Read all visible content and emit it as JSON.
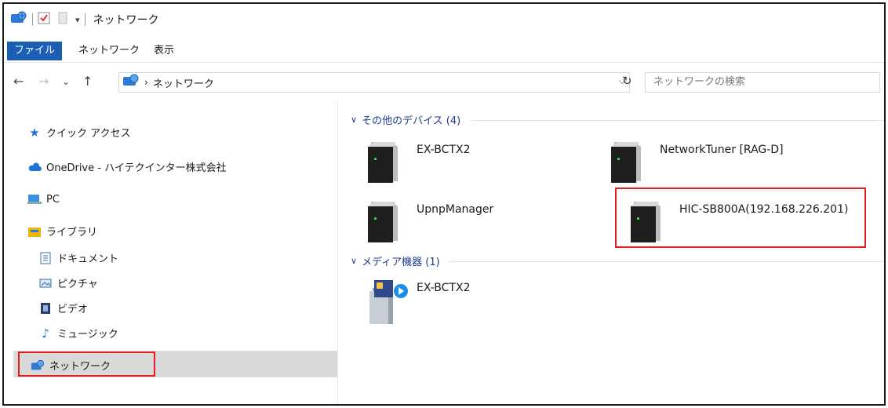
{
  "window": {
    "title": "ネットワーク"
  },
  "ribbon": {
    "tabs": [
      "ファイル",
      "ネットワーク",
      "表示"
    ]
  },
  "address": {
    "path": "ネットワーク",
    "search_placeholder": "ネットワークの検索"
  },
  "nav": {
    "quick_access": "クイック アクセス",
    "onedrive": "OneDrive - ハイテクインター株式会社",
    "pc": "PC",
    "library": "ライブラリ",
    "documents": "ドキュメント",
    "pictures": "ピクチャ",
    "videos": "ビデオ",
    "music": "ミュージック",
    "network": "ネットワーク"
  },
  "groups": {
    "other": {
      "title": "その他のデバイス (4)",
      "devices": [
        "EX-BCTX2",
        "NetworkTuner [RAG-D]",
        "UpnpManager",
        "HIC-SB800A(192.168.226.201)"
      ]
    },
    "media": {
      "title": "メディア機器 (1)",
      "devices": [
        "EX-BCTX2"
      ]
    }
  },
  "colors": {
    "accent": "#1a5fb4",
    "highlight": "#e02020",
    "group_header": "#1e3a8a"
  }
}
